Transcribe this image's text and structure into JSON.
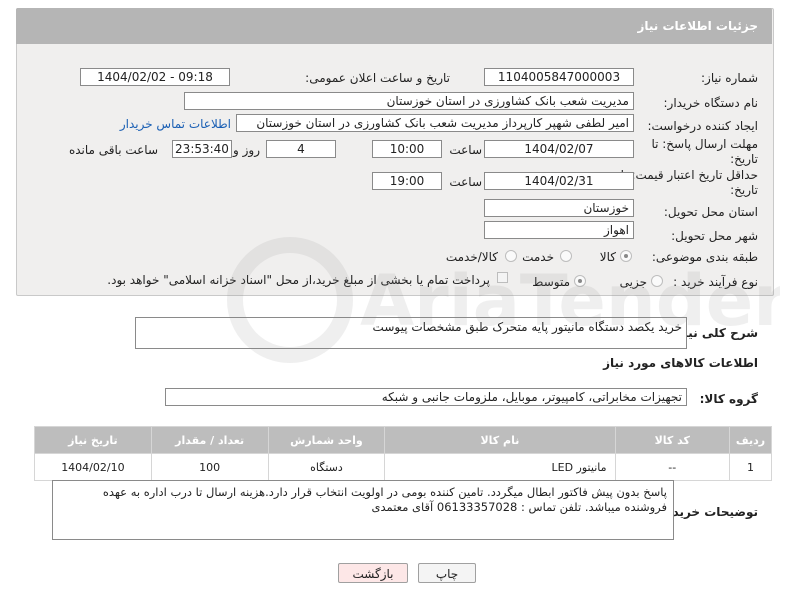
{
  "header": {
    "title": "جزئیات اطلاعات نیاز"
  },
  "fields": {
    "need_number_label": "شماره نیاز:",
    "need_number": "1104005847000003",
    "announce_label": "تاریخ و ساعت اعلان عمومی:",
    "announce_value": "1404/02/02 - 09:18",
    "buyer_org_label": "نام دستگاه خریدار:",
    "buyer_org": "مدیریت شعب بانک کشاورزی در استان خوزستان",
    "creator_label": "ایجاد کننده درخواست:",
    "creator": "امیر لطفی شهپر کارپرداز مدیریت شعب بانک کشاورزی در استان خوزستان",
    "contact_link": "اطلاعات تماس خریدار",
    "deadline_label": "مهلت ارسال پاسخ: تا تاریخ:",
    "deadline_date": "1404/02/07",
    "time_label": "ساعت",
    "deadline_time": "10:00",
    "days_value": "4",
    "days_label": "روز و",
    "remaining_time": "23:53:40",
    "remaining_label": "ساعت باقی مانده",
    "price_validity_label": "حداقل تاریخ اعتبار قیمت: تا تاریخ:",
    "price_validity_date": "1404/02/31",
    "price_validity_time": "19:00",
    "province_label": "استان محل تحویل:",
    "province": "خوزستان",
    "city_label": "شهر محل تحویل:",
    "city": "اهواز",
    "category_label": "طبقه بندی موضوعی:",
    "category_options": [
      "کالا",
      "خدمت",
      "کالا/خدمت"
    ],
    "process_label": "نوع فرآیند خرید :",
    "process_options": [
      "جزیی",
      "متوسط"
    ],
    "payment_note": "پرداخت تمام یا بخشی از مبلغ خرید،از محل \"اسناد خزانه اسلامی\" خواهد بود."
  },
  "description": {
    "label": "شرح کلی نیاز:",
    "text": "خرید یکصد دستگاه مانیتور پایه متحرک طبق مشخصات پیوست"
  },
  "goods_section": {
    "title": "اطلاعات کالاهای مورد نیاز",
    "group_label": "گروه کالا:",
    "group_value": "تجهیزات مخابراتی، کامپیوتر، موبایل، ملزومات جانبی و شبکه"
  },
  "table": {
    "headers": [
      "ردیف",
      "کد کالا",
      "نام کالا",
      "واحد شمارش",
      "تعداد / مقدار",
      "تاریخ نیاز"
    ],
    "rows": [
      [
        "1",
        "--",
        "مانیتور LED",
        "دستگاه",
        "100",
        "1404/02/10"
      ]
    ]
  },
  "buyer_notes": {
    "label": "توضیحات خریدار:",
    "line1": "پاسخ بدون پیش فاکتور ابطال میگردد. تامین کننده بومی در اولویت انتخاب قرار دارد.هزینه ارسال تا درب اداره به عهده",
    "line2": "فروشنده میباشد. تلفن تماس : 06133357028  آقای معتمدی"
  },
  "buttons": {
    "print": "چاپ",
    "back": "بازگشت"
  },
  "watermark": "AriaTender.neT",
  "colors": {
    "header_bg": "#b5b5b5",
    "panel_bg": "#f0efee",
    "link": "#1a5fb4",
    "back_button_bg": "#fde7e7"
  }
}
